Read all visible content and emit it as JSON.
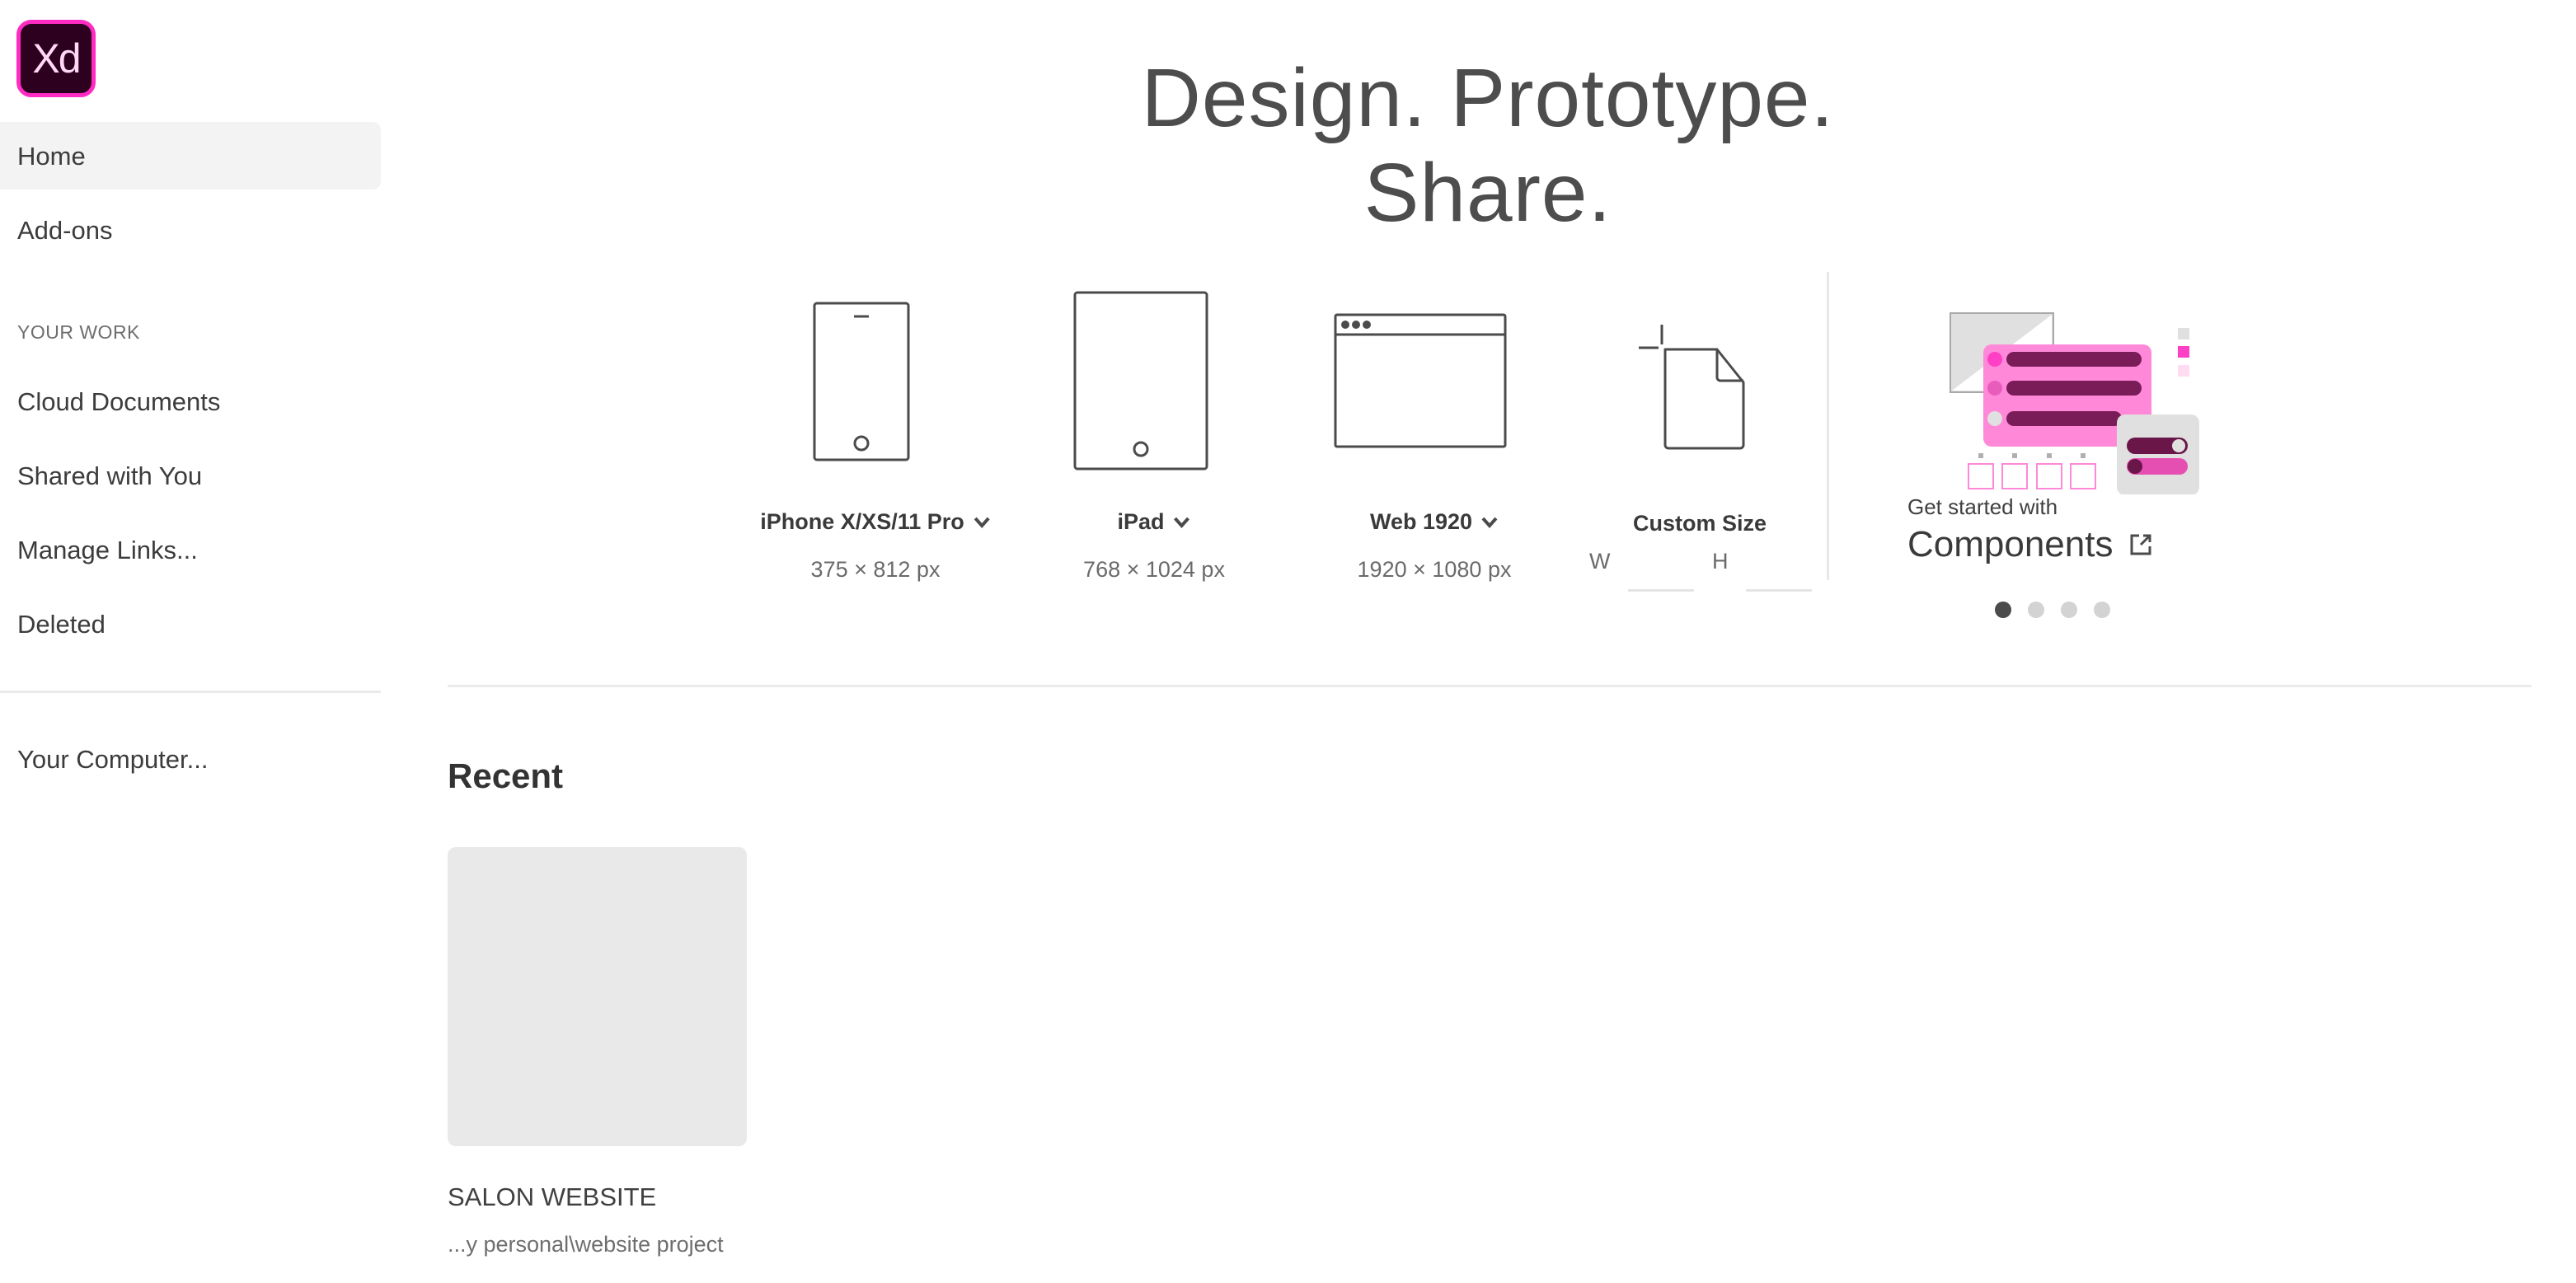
{
  "app": {
    "logo_text": "Xd",
    "brand_color": "#ff2bc2"
  },
  "sidebar": {
    "items": [
      {
        "label": "Home",
        "active": true
      },
      {
        "label": "Add-ons",
        "active": false
      }
    ],
    "section_label": "YOUR WORK",
    "work_items": [
      {
        "label": "Cloud Documents"
      },
      {
        "label": "Shared with You"
      },
      {
        "label": "Manage Links..."
      },
      {
        "label": "Deleted"
      }
    ],
    "bottom_items": [
      {
        "label": "Your Computer..."
      }
    ]
  },
  "hero": {
    "title": "Design. Prototype. Share."
  },
  "presets": [
    {
      "label": "iPhone X/XS/11 Pro",
      "size": "375 × 812 px",
      "icon": "phone-icon",
      "has_dropdown": true
    },
    {
      "label": "iPad",
      "size": "768 × 1024 px",
      "icon": "tablet-icon",
      "has_dropdown": true
    },
    {
      "label": "Web 1920",
      "size": "1920 × 1080 px",
      "icon": "browser-window-icon",
      "has_dropdown": true
    },
    {
      "label": "Custom Size",
      "icon": "custom-document-icon",
      "width_label": "W",
      "height_label": "H",
      "width_value": "",
      "height_value": ""
    }
  ],
  "promo": {
    "eyebrow": "Get started with",
    "heading": "Components",
    "icon": "external-link-icon",
    "carousel": {
      "total": 4,
      "active_index": 0
    }
  },
  "recent": {
    "heading": "Recent",
    "files": [
      {
        "name": "SALON WEBSITE",
        "path": "...y personal\\website project"
      }
    ]
  }
}
